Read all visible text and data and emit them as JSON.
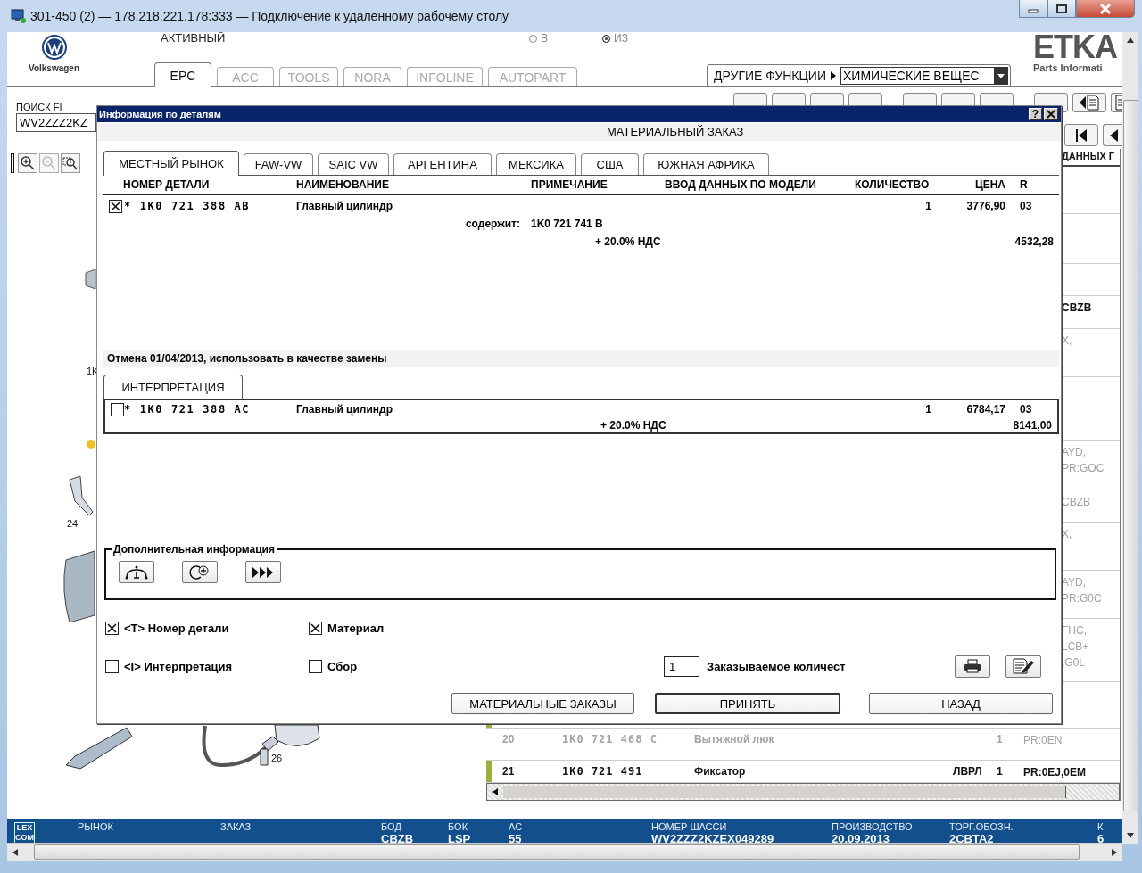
{
  "window": {
    "title": "301-450 (2) — 178.218.221.178:333 — Подключение к удаленному рабочему столу"
  },
  "app": {
    "brand": "Volkswagen",
    "status_text": "АКТИВНЫЙ",
    "radios": [
      {
        "label": "В",
        "selected": false
      },
      {
        "label": "ИЗ",
        "selected": true
      }
    ],
    "tabs": [
      {
        "label": "EPC",
        "selected": true
      },
      {
        "label": "ACC",
        "selected": false
      },
      {
        "label": "TOOLS",
        "selected": false
      },
      {
        "label": "NORA",
        "selected": false
      },
      {
        "label": "INFOLINE",
        "selected": false
      },
      {
        "label": "AUTOPART",
        "selected": false
      }
    ],
    "other_functions": "ДРУГИЕ ФУНКЦИИ",
    "function_select": "ХИМИЧЕСКИЕ ВЕЩЕС",
    "logo": "ETKA",
    "logo_sub": "Parts Informati",
    "search": {
      "label": "ПОИСК FI",
      "value": "WV2ZZZ2KZ"
    },
    "drawing_labels": [
      "1K",
      "24",
      "26"
    ],
    "list": {
      "header": "ДАННЫХ Г",
      "rows": [
        {
          "data": [
            "CBZB"
          ],
          "dimmed": false,
          "marked": false
        },
        {
          "data": [
            "X,"
          ],
          "dimmed": true,
          "marked": false
        },
        {
          "data": [
            "AYD,",
            "PR:GOC"
          ],
          "dimmed": true,
          "marked": false
        },
        {
          "data": [
            "CBZB"
          ],
          "dimmed": true,
          "marked": false
        },
        {
          "data": [
            "X,"
          ],
          "dimmed": true,
          "marked": false
        },
        {
          "data": [
            "AYD,",
            "PR:G0C"
          ],
          "dimmed": true,
          "marked": false
        },
        {
          "data": [
            "FHC,",
            "LCB+",
            ",G0L"
          ],
          "dimmed": true,
          "marked": false
        },
        {
          "marked": true,
          "dimmed": false
        },
        {
          "number": "20",
          "part": "1K0 721 468 C",
          "name": "Вытяжной люк",
          "qty": "1",
          "data": [
            "PR:0EN"
          ],
          "dimmed": true,
          "marked": false
        },
        {
          "number": "21",
          "part": "1K0 721 491",
          "name": "Фиксатор",
          "note": "ЛВРЛ",
          "qty": "1",
          "data": [
            "PR:0EJ,0EM"
          ],
          "dimmed": false,
          "marked": true
        }
      ]
    },
    "status_bar": {
      "logo": [
        "LEX",
        "COM"
      ],
      "items": [
        {
          "label": "РЫНОК"
        },
        {
          "label": "ЗАКАЗ"
        },
        {
          "label": "БОД",
          "value": "CBZB"
        },
        {
          "label": "БОК",
          "value": "LSP"
        },
        {
          "label": "AC",
          "value": "55"
        },
        {
          "label": "НОМЕР ШАССИ",
          "value": "WV2ZZZ2KZEX049289"
        },
        {
          "label": "ПРОИЗВОДСТВО",
          "value": "20.09.2013"
        },
        {
          "label": "ТОРГ.ОБОЗН.",
          "value": "2CBTA2"
        },
        {
          "label": "К",
          "value": "6"
        }
      ]
    }
  },
  "dialog": {
    "title": "Информация по деталям",
    "help": "?",
    "heading": "МАТЕРИАЛЬНЫЙ ЗАКАЗ",
    "tabs": [
      {
        "label": "МЕСТНЫЙ РЫНОК",
        "selected": true
      },
      {
        "label": "FAW-VW",
        "selected": false
      },
      {
        "label": "SAIC VW",
        "selected": false
      },
      {
        "label": "АРГЕНТИНА",
        "selected": false
      },
      {
        "label": "МЕКСИКА",
        "selected": false
      },
      {
        "label": "США",
        "selected": false
      },
      {
        "label": "ЮЖНАЯ АФРИКА",
        "selected": false
      }
    ],
    "columns": [
      "НОМЕР ДЕТАЛИ",
      "НАИМЕНОВАНИЕ",
      "ПРИМЕЧАНИЕ",
      "ВВОД ДАННЫХ ПО МОДЕЛИ",
      "КОЛИЧЕСТВО",
      "ЦЕНА",
      "R"
    ],
    "parts": [
      {
        "checked": true,
        "number": "* 1K0 721 388 AB",
        "name": "Главный цилиндр",
        "qty": "1",
        "price": "3776,90",
        "r": "03",
        "contains_label": "содержит:",
        "contains": "1K0 721 741 B",
        "vat": "+ 20.0% НДС",
        "vat_price": "4532,28"
      }
    ],
    "notice": "Отмена 01/04/2013, использовать в качестве замены",
    "interpretation": {
      "tab": "ИНТЕРПРЕТАЦИЯ",
      "parts": [
        {
          "checked": false,
          "number": "* 1K0 721 388 AC",
          "name": "Главный цилиндр",
          "qty": "1",
          "price": "6784,17",
          "r": "03",
          "vat": "+ 20.0% НДС",
          "vat_price": "8141,00"
        }
      ]
    },
    "extra_legend": "Дополнительная информация",
    "options": [
      {
        "label": "<T> Номер детали",
        "checked": true
      },
      {
        "label": "Материал",
        "checked": true
      },
      {
        "label": "<I> Интерпретация",
        "checked": false
      },
      {
        "label": "Сбор",
        "checked": false
      }
    ],
    "quantity": {
      "value": "1",
      "label": "Заказываемое количест"
    },
    "buttons": [
      {
        "label": "МАТЕРИАЛЬНЫЕ ЗАКАЗЫ",
        "default": false
      },
      {
        "label": "ПРИНЯТЬ",
        "default": true
      },
      {
        "label": "НАЗАД",
        "default": false
      }
    ]
  }
}
